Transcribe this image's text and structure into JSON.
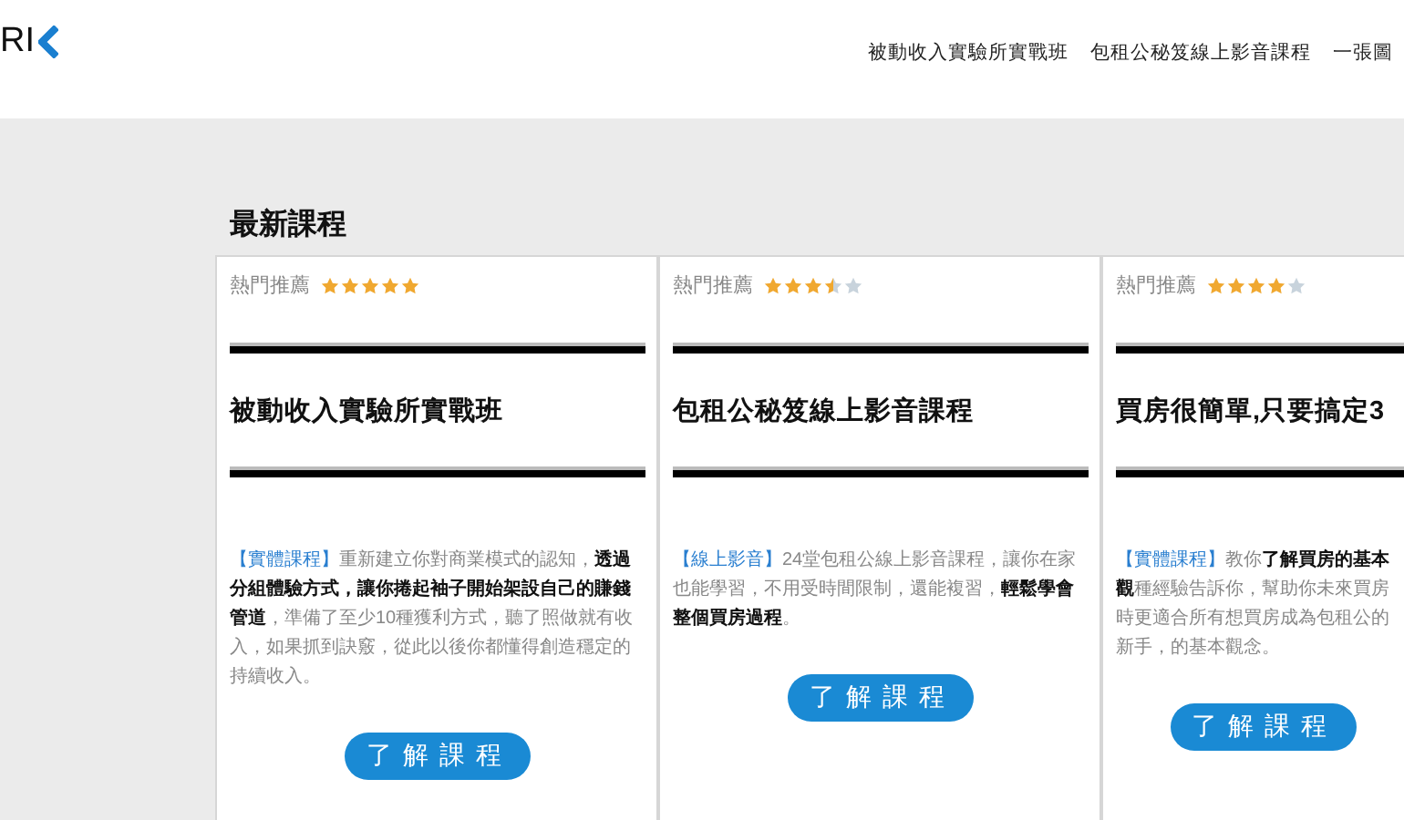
{
  "header": {
    "logo_text": "RI",
    "nav": [
      "被動收入實驗所實戰班",
      "包租公秘笈線上影音課程",
      "一張圖"
    ]
  },
  "section_title": "最新課程",
  "courses": [
    {
      "badge": "熱門推薦",
      "stars": 5,
      "title": "被動收入實驗所實戰班",
      "tag": "【實體課程】",
      "description": "重新建立你對商業模式的認知，**透過分組體驗方式，讓你捲起袖子開始架設自己的賺錢管道**，準備了至少10種獲利方式，聽了照做就有收入，如果抓到訣竅，從此以後你都懂得創造穩定的持續收入。",
      "button": "了解課程"
    },
    {
      "badge": "熱門推薦",
      "stars": 3.5,
      "title": "包租公秘笈線上影音課程",
      "tag": "【線上影音】",
      "description": "24堂包租公線上影音課程，讓你在家也能學習，不用受時間限制，還能複習，**輕鬆學會整個買房過程**。",
      "button": "了解課程"
    },
    {
      "badge": "熱門推薦",
      "stars": 4,
      "title": "買房很簡單,只要搞定3",
      "tag": "【實體課程】",
      "description": "教你**了解買房的基本觀**種經驗告訴你，幫助你未來買房時更適合所有想買房成為包租公的新手，的基本觀念。",
      "button": "了解課程"
    }
  ]
}
